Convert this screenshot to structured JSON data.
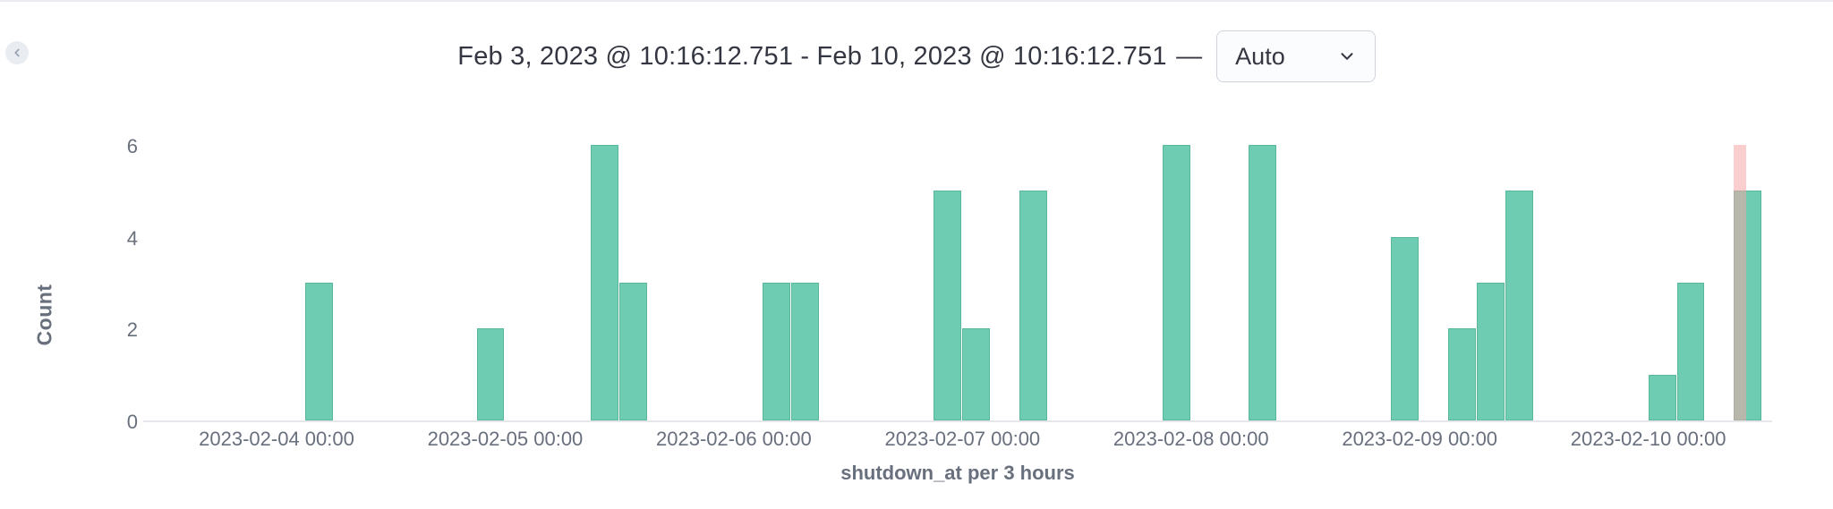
{
  "header": {
    "range_text": "Feb 3, 2023 @ 10:16:12.751 - Feb 10, 2023 @ 10:16:12.751",
    "range_dash": "—",
    "interval_selected": "Auto",
    "back_icon_name": "chevron-left-icon",
    "chevron_icon_name": "chevron-down-icon"
  },
  "colors": {
    "bar_fill": "#6dccb1",
    "bar_stroke": "#5bb79c",
    "partial_overlay": "#f5a6a6",
    "axis_text": "#69707d"
  },
  "chart_data": {
    "type": "bar",
    "title": "",
    "xlabel": "shutdown_at per 3 hours",
    "ylabel": "Count",
    "ylim": [
      0,
      6
    ],
    "y_ticks": [
      0,
      2,
      4,
      6
    ],
    "x_domain_hours": [
      0,
      171
    ],
    "x_tick_labels": [
      {
        "hour": 14,
        "label": "2023-02-04 00:00"
      },
      {
        "hour": 38,
        "label": "2023-02-05 00:00"
      },
      {
        "hour": 62,
        "label": "2023-02-06 00:00"
      },
      {
        "hour": 86,
        "label": "2023-02-07 00:00"
      },
      {
        "hour": 110,
        "label": "2023-02-08 00:00"
      },
      {
        "hour": 134,
        "label": "2023-02-09 00:00"
      },
      {
        "hour": 158,
        "label": "2023-02-10 00:00"
      }
    ],
    "bucket_width_hours": 3,
    "series": [
      {
        "name": "Count",
        "buckets": [
          {
            "start_hour": 17,
            "value": 3
          },
          {
            "start_hour": 35,
            "value": 2
          },
          {
            "start_hour": 47,
            "value": 6
          },
          {
            "start_hour": 50,
            "value": 3
          },
          {
            "start_hour": 65,
            "value": 3
          },
          {
            "start_hour": 68,
            "value": 3
          },
          {
            "start_hour": 83,
            "value": 5
          },
          {
            "start_hour": 86,
            "value": 2
          },
          {
            "start_hour": 92,
            "value": 5
          },
          {
            "start_hour": 107,
            "value": 6
          },
          {
            "start_hour": 116,
            "value": 6
          },
          {
            "start_hour": 131,
            "value": 4
          },
          {
            "start_hour": 137,
            "value": 2
          },
          {
            "start_hour": 140,
            "value": 3
          },
          {
            "start_hour": 143,
            "value": 5
          },
          {
            "start_hour": 158,
            "value": 1
          },
          {
            "start_hour": 161,
            "value": 3
          },
          {
            "start_hour": 167,
            "value": 5
          }
        ]
      }
    ],
    "partial_bucket": {
      "start_hour": 167,
      "end_hour": 168.27,
      "height_value": 6
    }
  }
}
